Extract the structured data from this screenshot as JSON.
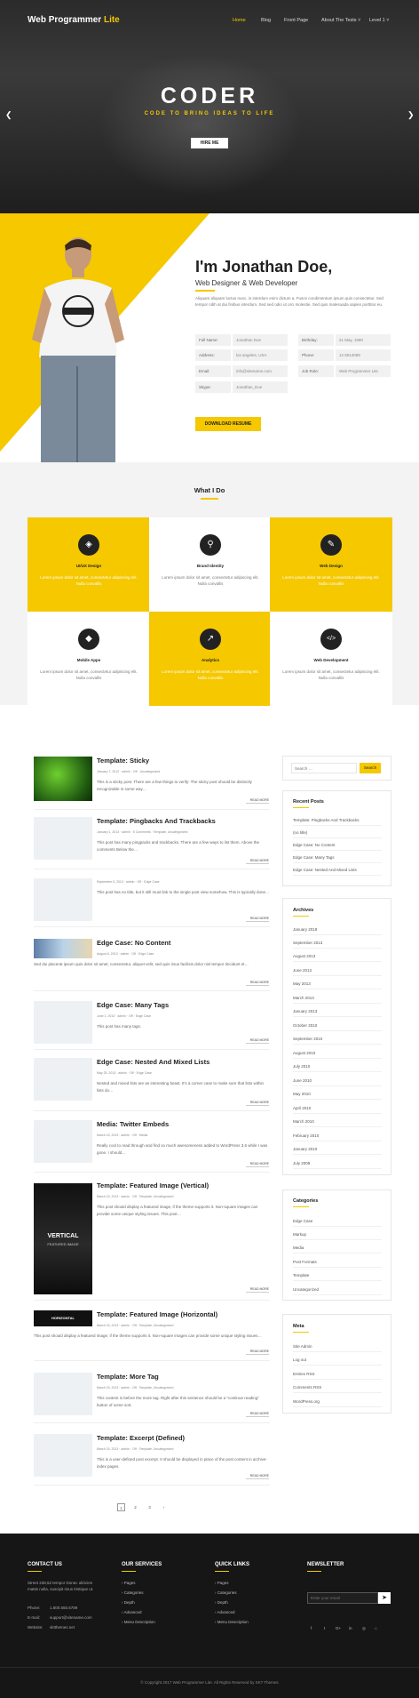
{
  "header": {
    "logo_primary": "Web Programmer",
    "logo_accent": " Lite",
    "nav": [
      "Home",
      "Blog",
      "Front Page",
      "About The Tests ˅",
      "Level 1 ˅"
    ],
    "hero_title": "CODER",
    "hero_subtitle": "CODE TO BRING IDEAS TO LIFE",
    "hire_button": "HIRE ME",
    "prev_icon": "chevron-left-icon",
    "next_icon": "chevron-right-icon"
  },
  "about": {
    "name": "I'm Jonathan Doe,",
    "role": "Web Designer & Web Developer",
    "bio": "Aliquam aliquam luctus nunc, in interdum enim dictum a. Fusce condimentum ipsum quis consectetur. Sed tempor nibh at dui finibus interdum. Sed sed odio ut orci molestie. Sed quis malesuada sapien porttitor eu.",
    "info_left": [
      {
        "label": "Full Name:",
        "value": "Jonathan Doe"
      },
      {
        "label": "Address:",
        "value": "los angeles, USA"
      },
      {
        "label": "Email:",
        "value": "info@sitename.com"
      },
      {
        "label": "Skype:",
        "value": "Jonathan_Doe"
      }
    ],
    "info_right": [
      {
        "label": "Birthday:",
        "value": "21 May, 1990"
      },
      {
        "label": "Phone:",
        "value": "12 8014099"
      },
      {
        "label": "Job Role:",
        "value": "Web Programmer Lite"
      }
    ],
    "download_button": "DOWNLOAD RESUME",
    "accent_color": "#f5c800"
  },
  "services": {
    "title": "What I Do",
    "tiles": [
      {
        "title": "UI/UX Design",
        "desc": "Lorem ipsum dolor sit amet, consectetur adipiscing elit. Nulla convallis",
        "icon": "layers-icon",
        "glyph": "◈"
      },
      {
        "title": "Brand Identity",
        "desc": "Lorem ipsum dolor sit amet, consectetur adipiscing elit. Nulla convallis",
        "icon": "pin-icon",
        "glyph": "⚲"
      },
      {
        "title": "Web Design",
        "desc": "Lorem ipsum dolor sit amet, consectetur adipiscing elit. Nulla convallis",
        "icon": "pencil-icon",
        "glyph": "✎"
      },
      {
        "title": "Mobile Apps",
        "desc": "Lorem ipsum dolor sit amet, consectetur adipiscing elit. Nulla convallis",
        "icon": "diamond-icon",
        "glyph": "◆"
      },
      {
        "title": "Analytics",
        "desc": "Lorem ipsum dolor sit amet, consectetur adipiscing elit. Nulla convallis",
        "icon": "chart-icon",
        "glyph": "↗"
      },
      {
        "title": "Web Development",
        "desc": "Lorem ipsum dolor sit amet, consectetur adipiscing elit. Nulla convallis",
        "icon": "code-icon",
        "glyph": "</>"
      }
    ]
  },
  "posts": [
    {
      "title": "Template: Sticky",
      "meta": "January 7, 2012  ·  admin  ·  Off  ·  Uncategorized",
      "excerpt": "This is a sticky post. There are a few things to verify: The sticky post should be distinctly recognizable in some way…",
      "read": "READ MORE"
    },
    {
      "title": "Template: Pingbacks And Trackbacks",
      "meta": "January 1, 2013  ·  admin  ·  5 Comments  ·  Template, Uncategorized",
      "excerpt": "This post has many pingpacks and trackbacks. There are a few ways to list them. Above the comments Below the…",
      "read": "READ MORE"
    },
    {
      "title": "",
      "meta": "September 5, 2013  ·  admin  ·  Off  ·  Edge Case",
      "excerpt": "This post has no title, but it still must link to the single post view somehow. This is typically done…",
      "read": "READ MORE"
    },
    {
      "title": "Edge Case: No Content",
      "meta": "August 6, 2013  ·  admin  ·  Off  ·  Edge Case",
      "excerpt": "Sed dui placerat ipsum quis dolor sit amet, consectetur, aliquet velit, sed quis risus facilisis dolor nisl tempor tincidunt et…",
      "read": "READ MORE"
    },
    {
      "title": "Edge Case: Many Tags",
      "meta": "June 1, 2013  ·  admin  ·  Off  ·  Edge Case",
      "excerpt": "This post has many tags.",
      "read": "READ MORE"
    },
    {
      "title": "Edge Case: Nested And Mixed Lists",
      "meta": "May 25, 2013  ·  admin  ·  Off  ·  Edge Case",
      "excerpt": "Nested and mixed lists are an interesting beast. It's a corner case to make sure that lists within lists do…",
      "read": "READ MORE"
    },
    {
      "title": "Media: Twitter Embeds",
      "meta": "March 15, 2013  ·  admin  ·  Off  ·  Media",
      "excerpt": "Really cool to read through and find so much awesomeness added to WordPress 3.6 while I was gone. I should…",
      "read": "READ MORE"
    },
    {
      "title": "Template: Featured Image (Vertical)",
      "meta": "March 15, 2013  ·  admin  ·  Off  ·  Template, Uncategorized",
      "excerpt": "This post should display a featured image, if the theme supports it. Non-square images can provide some unique styling issues. This post…",
      "read": "READ MORE",
      "thumb_title": "VERTICAL",
      "thumb_sub": "FEATURED IMAGE"
    },
    {
      "title": "Template: Featured Image (Horizontal)",
      "meta": "March 15, 2013  ·  admin  ·  Off  ·  Template, Uncategorized",
      "excerpt": "This post should display a featured image, if the theme supports it. Non-square images can provide some unique styling issues…",
      "read": "READ MORE",
      "thumb_title": "HORIZONTAL"
    },
    {
      "title": "Template: More Tag",
      "meta": "March 15, 2013  ·  admin  ·  Off  ·  Template, Uncategorized",
      "excerpt": "This content is before the more tag. Right after this sentence should be a \"continue reading\" button of some sort.",
      "read": "READ MORE"
    },
    {
      "title": "Template: Excerpt (Defined)",
      "meta": "March 15, 2013  ·  admin  ·  Off  ·  Template, Uncategorized",
      "excerpt": "This is a user-defined post excerpt. It should be displayed in place of the post content in archive-index pages.",
      "read": "READ MORE"
    }
  ],
  "pagination": [
    "1",
    "2",
    "3",
    "›"
  ],
  "sidebar": {
    "search_placeholder": "Search …",
    "search_button": "Search",
    "recent_title": "Recent Posts",
    "recent": [
      "Template: Pingbacks And Trackbacks",
      "(no title)",
      "Edge Case: No Content",
      "Edge Case: Many Tags",
      "Edge Case: Nested And Mixed Lists"
    ],
    "archives_title": "Archives",
    "archives": [
      "January 2018",
      "September 2013",
      "August 2013",
      "June 2013",
      "May 2013",
      "March 2013",
      "January 2013",
      "October 2010",
      "September 2010",
      "August 2010",
      "July 2010",
      "June 2010",
      "May 2010",
      "April 2010",
      "March 2010",
      "February 2010",
      "January 2010",
      "July 2009"
    ],
    "categories_title": "Categories",
    "categories": [
      "Edge Case",
      "Markup",
      "Media",
      "Post Formats",
      "Template",
      "Uncategorized"
    ],
    "meta_title": "Meta",
    "meta": [
      "Site Admin",
      "Log out",
      "Entries RSS",
      "Comments RSS",
      "WordPress.org"
    ]
  },
  "footer": {
    "contact_title": "CONTACT US",
    "contact_address": "Street 238,52 tempor Donec ultricies mattis nulla, suscipit risus tristique ut.",
    "contact_rows": [
      {
        "label": "Phone:",
        "value": "1.800.555.6789"
      },
      {
        "label": "E-mail:",
        "value": "support@sitename.com"
      },
      {
        "label": "Website:",
        "value": "sktthemes.net"
      }
    ],
    "services_title": "OUR SERVICES",
    "services": [
      "Pages",
      "Categories",
      "Depth",
      "Advanced",
      "Menu Description"
    ],
    "links_title": "QUICK LINKS",
    "links": [
      "Pages",
      "Categories",
      "Depth",
      "Advanced",
      "Menu Description"
    ],
    "newsletter_title": "NEWSLETTER",
    "newsletter_placeholder": "Enter your email",
    "social": [
      "f",
      "t",
      "G+",
      "in",
      "◎",
      "⌂"
    ],
    "copyright": "© Copyright 2017 Web Programmer Lite. All Rights Reserved by SKT Themes"
  }
}
